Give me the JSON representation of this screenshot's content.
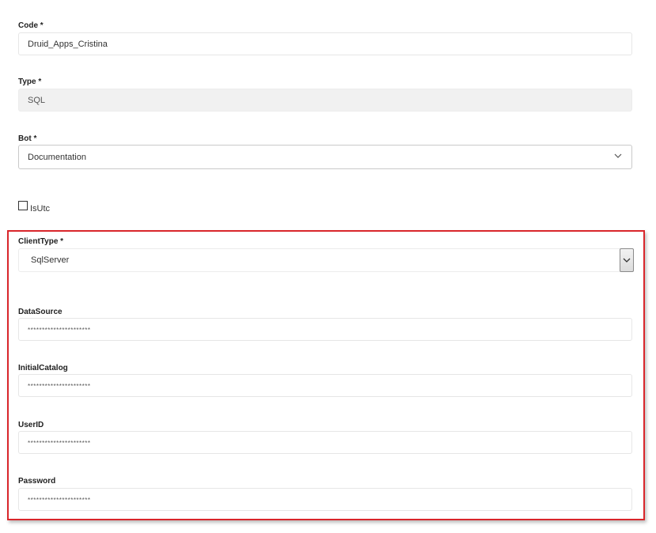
{
  "form": {
    "code": {
      "label": "Code *",
      "value": "Druid_Apps_Cristina"
    },
    "type": {
      "label": "Type *",
      "value": "SQL"
    },
    "bot": {
      "label": "Bot *",
      "value": "Documentation"
    },
    "is_utc": {
      "label": "IsUtc",
      "checked": false
    }
  },
  "connection": {
    "highlight_color": "#d9262b",
    "client_type": {
      "label": "ClientType *",
      "value": "SqlServer"
    },
    "data_source": {
      "label": "DataSource",
      "value": "**********************"
    },
    "initial_catalog": {
      "label": "InitialCatalog",
      "value": "**********************"
    },
    "user_id": {
      "label": "UserID",
      "value": "**********************"
    },
    "password": {
      "label": "Password",
      "value": "**********************"
    }
  }
}
